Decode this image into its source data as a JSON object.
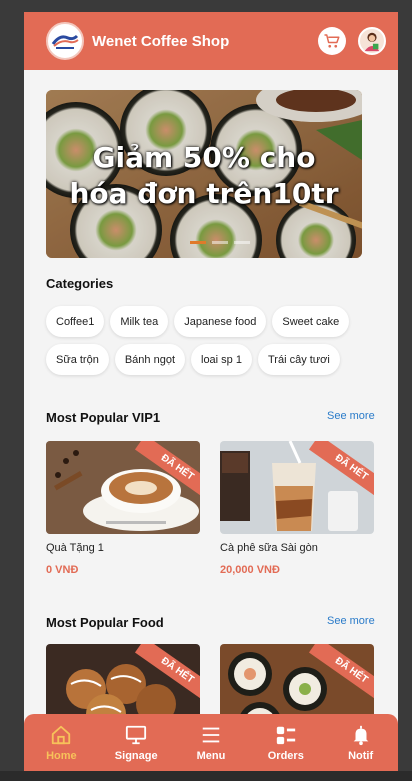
{
  "header": {
    "shop_name": "Wenet Coffee Shop"
  },
  "banner": {
    "line1": "Giảm 50% cho",
    "line2": "hóa đơn trên10tr",
    "slides": 3,
    "active_slide": 0
  },
  "categories": {
    "title": "Categories",
    "items": [
      "Coffee1",
      "Milk tea",
      "Japanese food",
      "Sweet cake",
      "Sữa trộn",
      "Bánh ngọt",
      "loai sp 1",
      "Trái cây tươi"
    ]
  },
  "vip": {
    "title": "Most Popular VIP1",
    "see_more": "See more",
    "products": [
      {
        "name": "Quà Tặng 1",
        "price": "0 VNĐ",
        "badge": "ĐÃ HẾT"
      },
      {
        "name": "Cà phê sữa Sài gòn",
        "price": "20,000 VNĐ",
        "badge": "ĐÃ HẾT"
      }
    ]
  },
  "food": {
    "title": "Most Popular Food",
    "see_more": "See more",
    "products": [
      {
        "badge": "ĐÃ HẾT"
      },
      {
        "badge": "ĐÃ HẾT"
      }
    ]
  },
  "nav": {
    "items": [
      {
        "label": "Home",
        "icon": "home-icon",
        "active": true
      },
      {
        "label": "Signage",
        "icon": "monitor-icon",
        "active": false
      },
      {
        "label": "Menu",
        "icon": "menu-icon",
        "active": false
      },
      {
        "label": "Orders",
        "icon": "orders-icon",
        "active": false
      },
      {
        "label": "Notif",
        "icon": "bell-icon",
        "active": false
      }
    ]
  },
  "colors": {
    "brand": "#e26b55",
    "active_nav": "#f7c25a",
    "link": "#2a7bc9"
  }
}
